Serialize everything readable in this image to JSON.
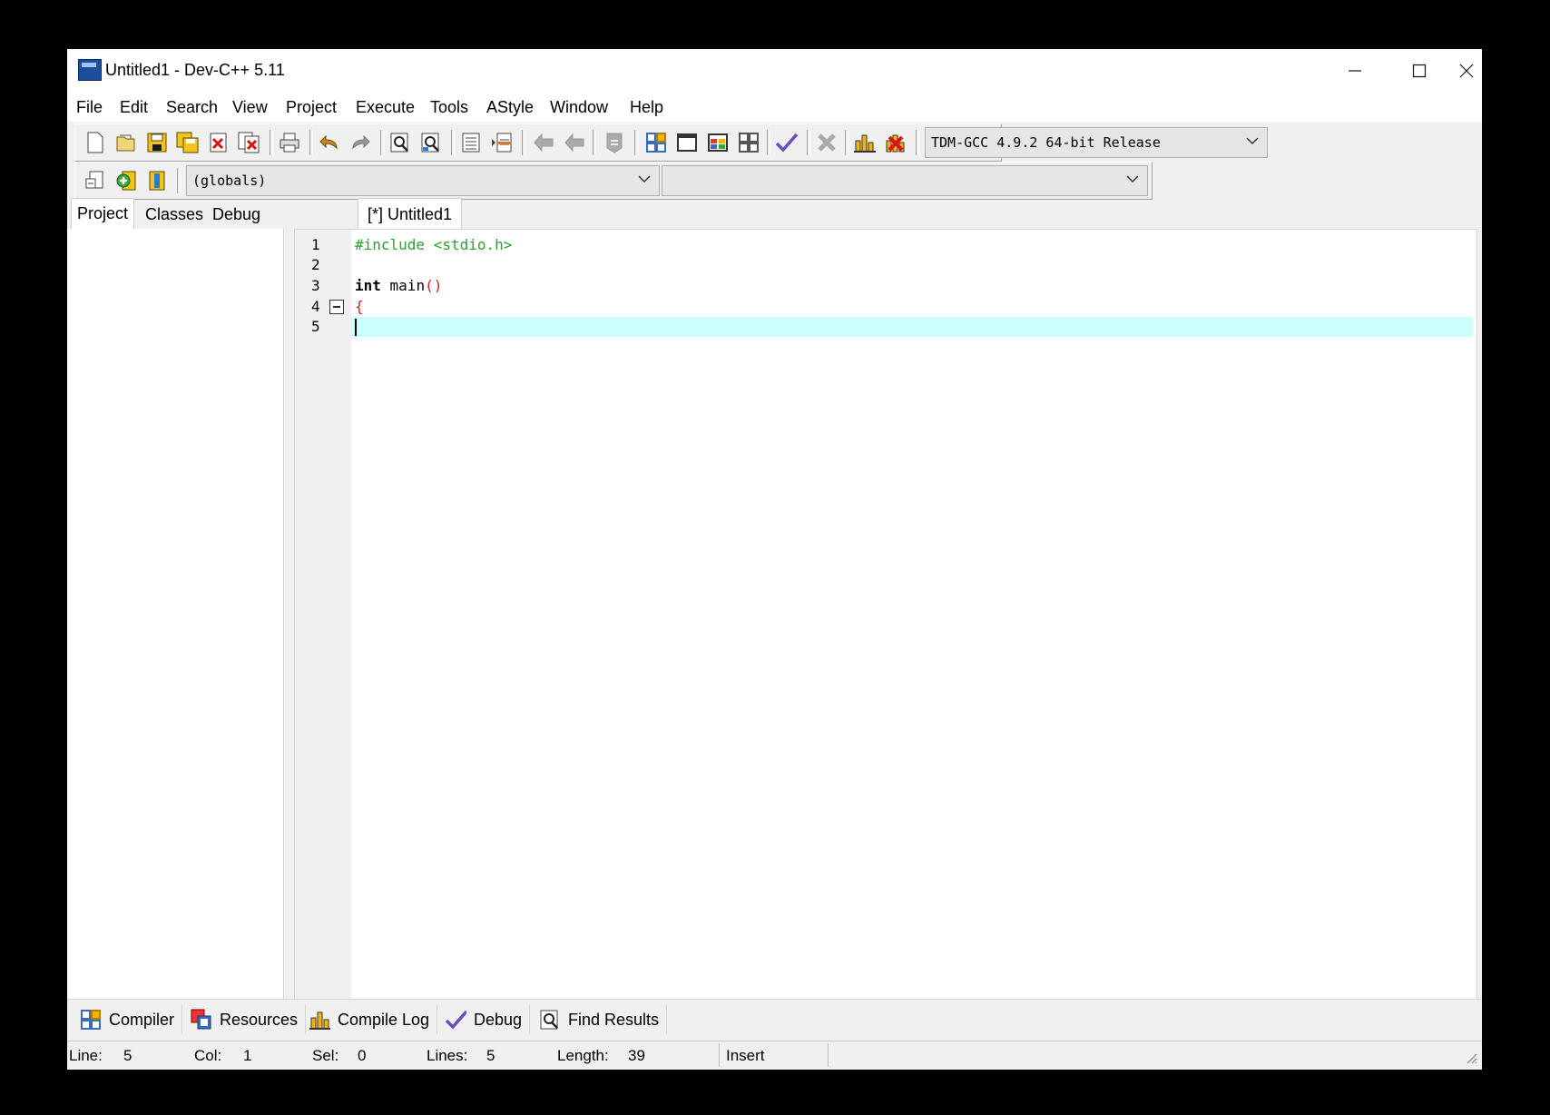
{
  "window": {
    "title": "Untitled1 - Dev-C++ 5.11",
    "controls": {
      "minimize": "—",
      "maximize": "☐",
      "close": "✕"
    }
  },
  "menu": [
    "File",
    "Edit",
    "Search",
    "View",
    "Project",
    "Execute",
    "Tools",
    "AStyle",
    "Window",
    "Help"
  ],
  "toolbar": {
    "compiler_select": "TDM-GCC 4.9.2 64-bit Release",
    "scope_select": "(globals)",
    "member_select": "",
    "icons": [
      "new-file-icon",
      "open-file-icon",
      "save-icon",
      "save-all-icon",
      "close-file-icon",
      "close-all-icon",
      "print-icon",
      "undo-icon",
      "redo-icon",
      "find-icon",
      "replace-icon",
      "indent-icon",
      "unindent-icon",
      "goto-back-icon",
      "goto-forward-icon",
      "bookmark-icon",
      "compile-icon",
      "run-icon",
      "compile-run-icon",
      "rebuild-icon",
      "syntax-check-icon",
      "stop-icon",
      "profile-icon",
      "delete-profile-icon",
      "new-class-icon",
      "add-file-icon",
      "remove-file-icon"
    ]
  },
  "left_panel": {
    "tabs": [
      "Project",
      "Classes",
      "Debug"
    ],
    "active_tab": "Project"
  },
  "editor": {
    "tab_label": "[*] Untitled1",
    "lines": [
      {
        "number": "1",
        "text": "#include <stdio.h>"
      },
      {
        "number": "2",
        "text": ""
      },
      {
        "number": "3",
        "kw": "int",
        "text": " main",
        "paren": "()"
      },
      {
        "number": "4",
        "brace": "{"
      },
      {
        "number": "5",
        "text": ""
      }
    ],
    "current_line": 5,
    "colors": {
      "preprocessor": "#2e9d2e",
      "bracket": "#e01b1b",
      "current_line_bg": "#ccffff"
    }
  },
  "bottom_tabs": [
    {
      "label": "Compiler",
      "icon": "compiler-grid-icon"
    },
    {
      "label": "Resources",
      "icon": "resources-icon"
    },
    {
      "label": "Compile Log",
      "icon": "compile-log-chart-icon"
    },
    {
      "label": "Debug",
      "icon": "debug-check-icon"
    },
    {
      "label": "Find Results",
      "icon": "find-results-icon"
    }
  ],
  "status": {
    "line_label": "Line:",
    "line_value": "5",
    "col_label": "Col:",
    "col_value": "1",
    "sel_label": "Sel:",
    "sel_value": "0",
    "lines_label": "Lines:",
    "lines_value": "5",
    "length_label": "Length:",
    "length_value": "39",
    "mode": "Insert"
  }
}
